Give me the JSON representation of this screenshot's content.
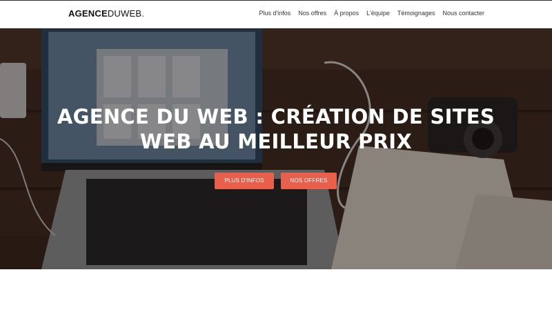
{
  "brand": {
    "part1": "AGENCE",
    "part2": "DUWEB."
  },
  "nav": {
    "items": [
      "Plus d'infos",
      "Nos offres",
      "À propos",
      "L'équipe",
      "Témoignages",
      "Nous contacter"
    ]
  },
  "hero": {
    "title_line1": "AGENCE DU WEB : CRÉATION DE SITES",
    "title_line2": "WEB AU MEILLEUR PRIX",
    "buttons": {
      "infos": "PLUS D'INFOS",
      "offres": "NOS OFFRES"
    }
  },
  "colors": {
    "accent": "#e8604c",
    "navbar_bg": "#ffffff",
    "hero_overlay": "#1a120c"
  }
}
